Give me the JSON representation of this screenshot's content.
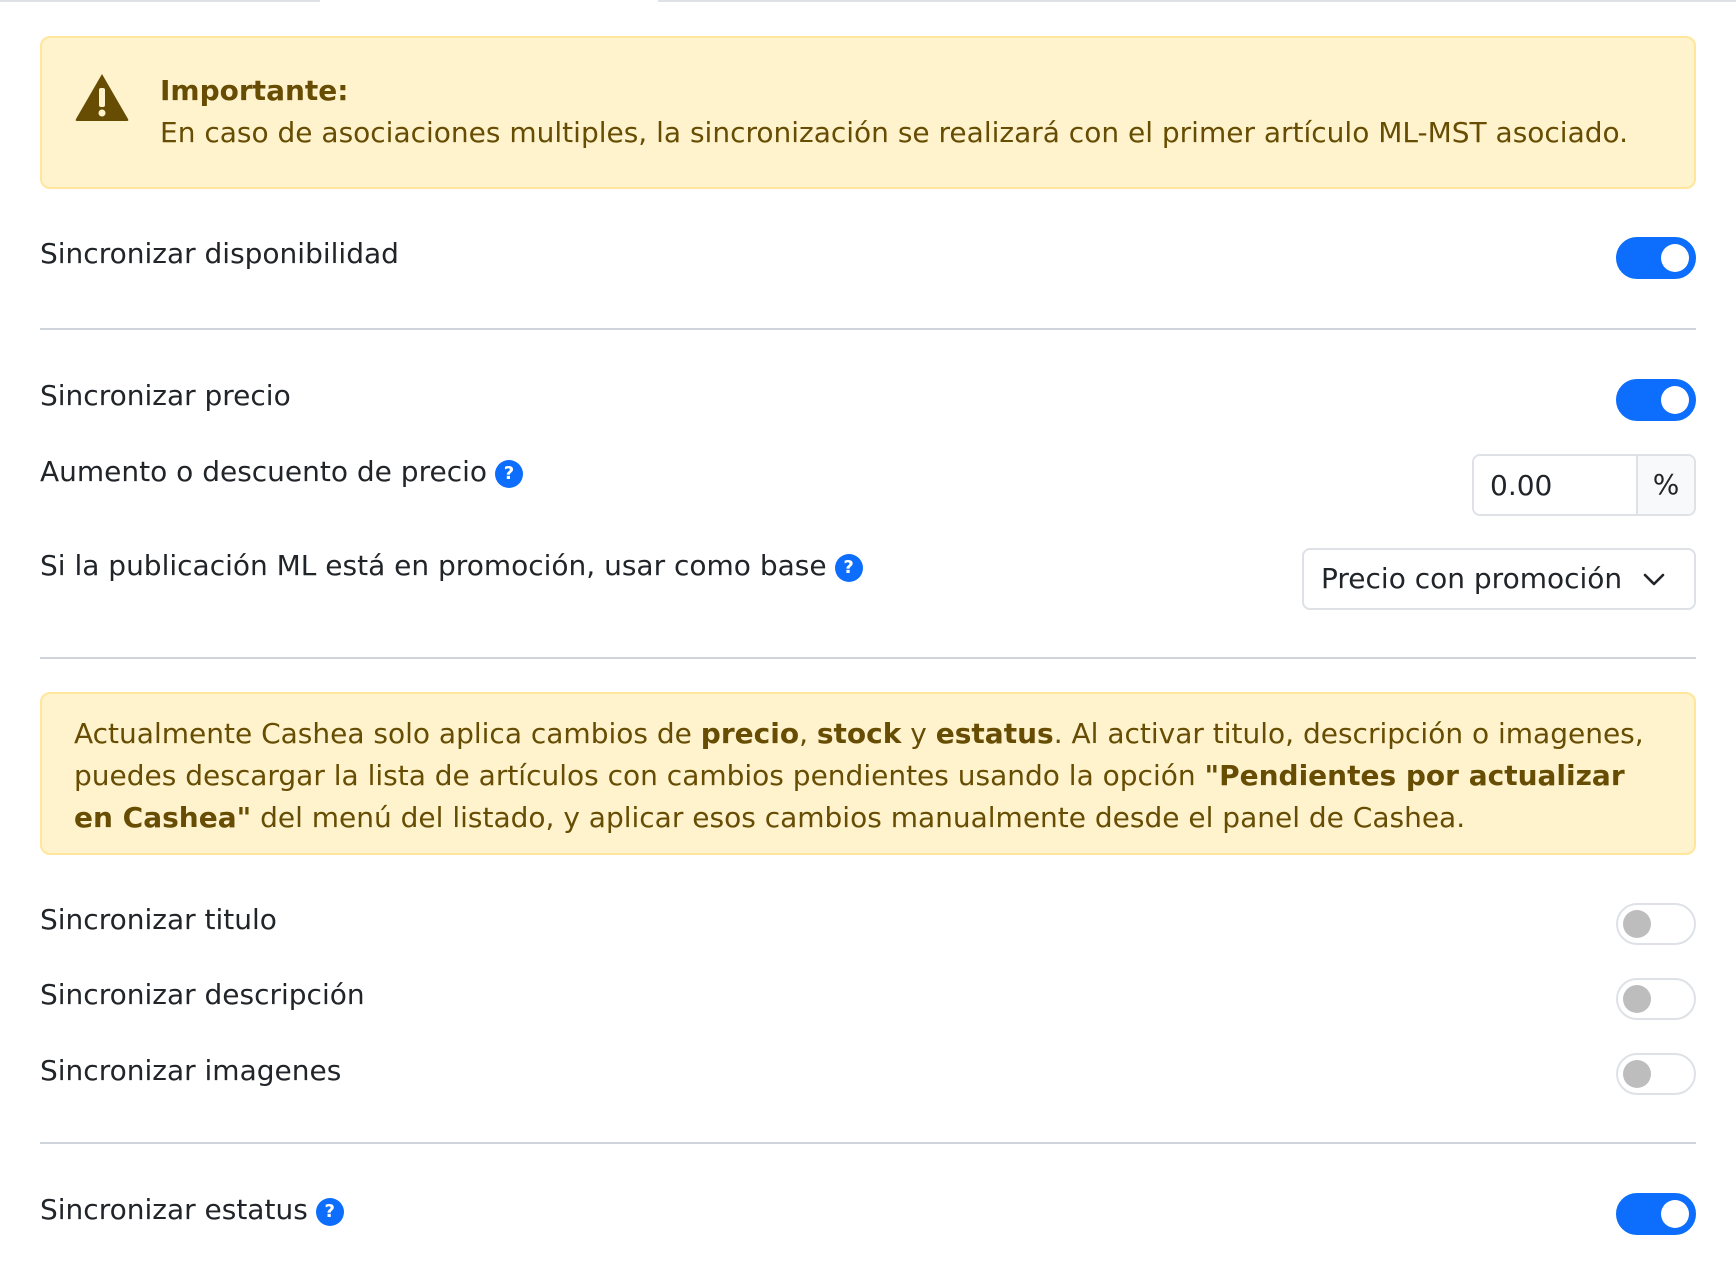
{
  "alert_important": {
    "title": "Importante:",
    "text": "En caso de asociaciones multiples, la sincronización se realizará con el primer artículo ML-MST asociado."
  },
  "sync_availability": {
    "label": "Sincronizar disponibilidad",
    "enabled": true
  },
  "sync_price": {
    "label": "Sincronizar precio",
    "enabled": true
  },
  "price_adjustment": {
    "label": "Aumento o descuento de precio",
    "value": "0.00",
    "unit": "%"
  },
  "promotion_base": {
    "label": "Si la publicación ML está en promoción, usar como base",
    "selected": "Precio con promoción"
  },
  "alert_cashea": {
    "t1": "Actualmente Cashea solo aplica cambios de ",
    "b1": "precio",
    "t2": ", ",
    "b2": "stock",
    "t3": " y ",
    "b3": "estatus",
    "t4": ". Al activar titulo, descripción o imagenes, puedes descargar la lista de artículos con cambios pendientes usando la opción ",
    "b4": "\"Pendientes por actualizar en Cashea\"",
    "t5": " del menú del listado, y aplicar esos cambios manualmente desde el panel de Cashea."
  },
  "sync_title": {
    "label": "Sincronizar titulo",
    "enabled": false
  },
  "sync_description": {
    "label": "Sincronizar descripción",
    "enabled": false
  },
  "sync_images": {
    "label": "Sincronizar imagenes",
    "enabled": false
  },
  "sync_status": {
    "label": "Sincronizar estatus",
    "enabled": true
  },
  "help_icon_glyph": "?",
  "colors": {
    "primary": "#0d6efd",
    "warning_bg": "#fff3cd",
    "warning_text": "#664d03"
  }
}
